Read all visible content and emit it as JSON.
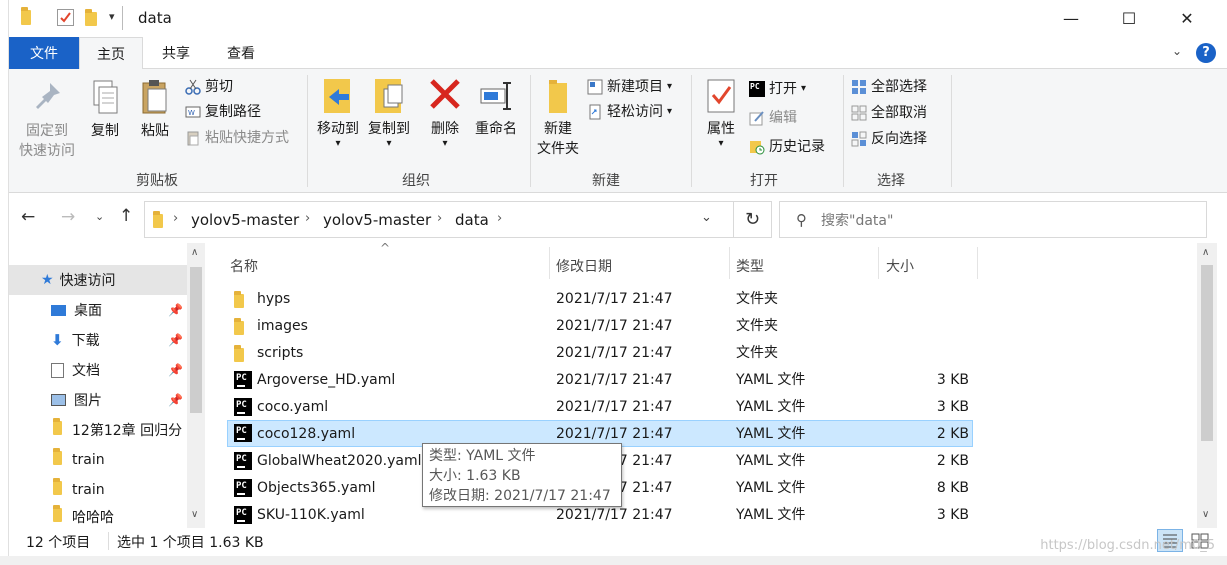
{
  "window": {
    "title": "data",
    "controls": {
      "minimize": "—",
      "maximize": "☐",
      "close": "✕"
    }
  },
  "tabs": [
    {
      "label": "文件"
    },
    {
      "label": "主页"
    },
    {
      "label": "共享"
    },
    {
      "label": "查看"
    }
  ],
  "ribbon": {
    "clipboard": {
      "label": "剪贴板",
      "pin": "固定到\n快速访问",
      "pin_line1": "固定到",
      "pin_line2": "快速访问",
      "copy": "复制",
      "paste": "粘贴",
      "cut": "剪切",
      "copy_path": "复制路径",
      "paste_shortcut": "粘贴快捷方式"
    },
    "organize": {
      "label": "组织",
      "move_to": "移动到",
      "copy_to": "复制到",
      "delete": "删除",
      "rename": "重命名"
    },
    "new": {
      "label": "新建",
      "new_folder_line1": "新建",
      "new_folder_line2": "文件夹",
      "new_item": "新建项目",
      "easy_access": "轻松访问"
    },
    "open": {
      "label": "打开",
      "properties": "属性",
      "open": "打开",
      "edit": "编辑",
      "history": "历史记录"
    },
    "select": {
      "label": "选择",
      "select_all": "全部选择",
      "select_none": "全部取消",
      "invert": "反向选择"
    }
  },
  "address": {
    "crumbs": [
      "yolov5-master",
      "yolov5-master",
      "data"
    ],
    "search_placeholder": "搜索\"data\""
  },
  "nav": {
    "items": [
      {
        "label": "快速访问",
        "pinned": false
      },
      {
        "label": "桌面",
        "pinned": true
      },
      {
        "label": "下载",
        "pinned": true
      },
      {
        "label": "文档",
        "pinned": true
      },
      {
        "label": "图片",
        "pinned": true
      },
      {
        "label": "12第12章  回归分",
        "pinned": false
      },
      {
        "label": "train",
        "pinned": false
      },
      {
        "label": "train",
        "pinned": false
      },
      {
        "label": "哈哈哈",
        "pinned": false
      }
    ]
  },
  "columns": {
    "name": "名称",
    "modified": "修改日期",
    "type": "类型",
    "size": "大小"
  },
  "files": [
    {
      "name": "hyps",
      "modified": "2021/7/17 21:47",
      "type": "文件夹",
      "size": "",
      "kind": "folder"
    },
    {
      "name": "images",
      "modified": "2021/7/17 21:47",
      "type": "文件夹",
      "size": "",
      "kind": "folder"
    },
    {
      "name": "scripts",
      "modified": "2021/7/17 21:47",
      "type": "文件夹",
      "size": "",
      "kind": "folder"
    },
    {
      "name": "Argoverse_HD.yaml",
      "modified": "2021/7/17 21:47",
      "type": "YAML 文件",
      "size": "3 KB",
      "kind": "pc"
    },
    {
      "name": "coco.yaml",
      "modified": "2021/7/17 21:47",
      "type": "YAML 文件",
      "size": "3 KB",
      "kind": "pc"
    },
    {
      "name": "coco128.yaml",
      "modified": "2021/7/17 21:47",
      "type": "YAML 文件",
      "size": "2 KB",
      "kind": "pc",
      "selected": true
    },
    {
      "name": "GlobalWheat2020.yaml",
      "modified": "2021/7/17 21:47",
      "type": "YAML 文件",
      "size": "2 KB",
      "kind": "pc"
    },
    {
      "name": "Objects365.yaml",
      "modified": "2021/7/17 21:47",
      "type": "YAML 文件",
      "size": "8 KB",
      "kind": "pc"
    },
    {
      "name": "SKU-110K.yaml",
      "modified": "2021/7/17 21:47",
      "type": "YAML 文件",
      "size": "3 KB",
      "kind": "pc"
    }
  ],
  "tooltip": {
    "type": "类型: YAML 文件",
    "size": "大小: 1.63 KB",
    "modified": "修改日期: 2021/7/17 21:47"
  },
  "status": {
    "count": "12 个项目",
    "selected": "选中 1 个项目  1.63 KB"
  },
  "watermark": "https://blog.csdn.net/m0_5"
}
